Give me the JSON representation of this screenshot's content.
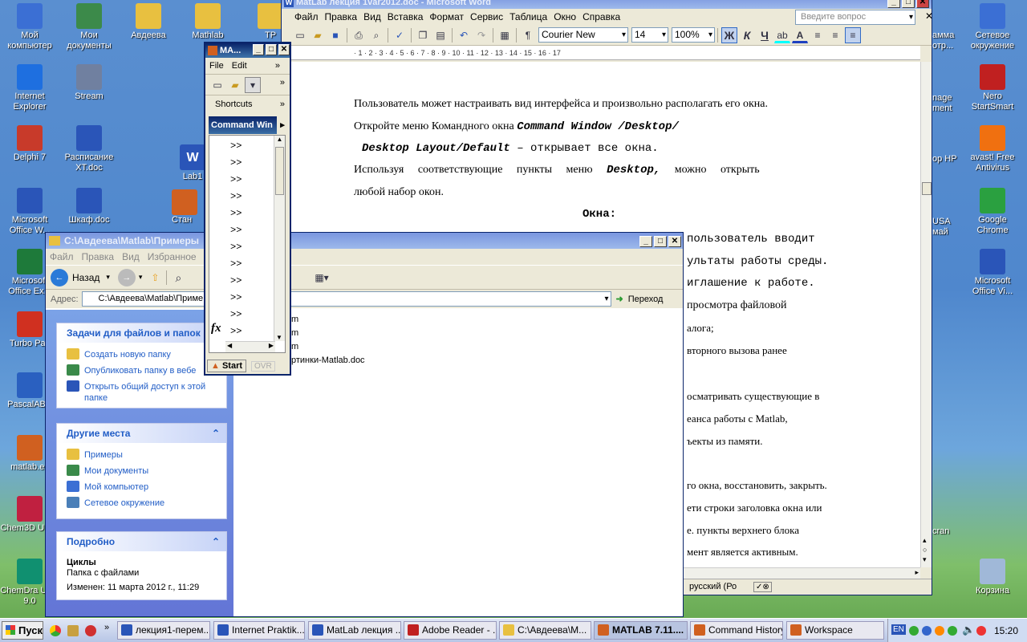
{
  "desktop_left": [
    {
      "label": "Мой компьютер",
      "color": "#3b6fd4"
    },
    {
      "label": "Internet Explorer",
      "color": "#1e6fe0"
    },
    {
      "label": "Delphi 7",
      "color": "#c83a2a"
    },
    {
      "label": "Microsoft Office W...",
      "color": "#2a55b8"
    },
    {
      "label": "Microsoft Office Ex...",
      "color": "#1e7a3a"
    },
    {
      "label": "Turbo Pas",
      "color": "#d03020"
    },
    {
      "label": "PascalABC",
      "color": "#2a60c0"
    },
    {
      "label": "matlab.ex",
      "color": "#d06020"
    },
    {
      "label": "Chem3D U 9.0",
      "color": "#c02040"
    },
    {
      "label": "ChemDra Ultra 9.0",
      "color": "#109070"
    }
  ],
  "desktop_col2": [
    {
      "label": "Мои документы",
      "color": "#3c8a4a"
    },
    {
      "label": "Stream",
      "color": "#7080a0"
    },
    {
      "label": "Расписание ХТ.doc",
      "color": "#2a55b8"
    },
    {
      "label": "Шкаф.doc",
      "color": "#2a55b8"
    }
  ],
  "desktop_top": [
    {
      "label": "Авдеева",
      "color": "#e8c040"
    },
    {
      "label": "Mathlab",
      "color": "#e8c040"
    },
    {
      "label": "TP",
      "color": "#e8c040"
    }
  ],
  "desktop_partial": {
    "lab": "Lab1",
    "stan": "Стан"
  },
  "desktop_right": [
    {
      "label": "Сетевое окружение",
      "color": "#3b6fd4"
    },
    {
      "label": "Nero StartSmart",
      "color": "#c02020"
    },
    {
      "label": "avast! Free Antivirus",
      "color": "#f07010"
    },
    {
      "label": "Google Chrome",
      "color": "#2aa040"
    },
    {
      "label": "Microsoft Office Vi...",
      "color": "#2a55b8"
    },
    {
      "label": "Корзина",
      "color": "#a0b8d8"
    }
  ],
  "desktop_right_partial": [
    "амма отр...",
    "nage ment",
    "op HP",
    "USA май",
    "cran"
  ],
  "word": {
    "title": "MatLab лекция 1var2012.doc - Microsoft Word",
    "menu": [
      "Файл",
      "Правка",
      "Вид",
      "Вставка",
      "Формат",
      "Сервис",
      "Таблица",
      "Окно",
      "Справка"
    ],
    "help_placeholder": "Введите вопрос",
    "font": "Courier New",
    "size": "14",
    "zoom": "100%",
    "ruler": "· 1 · 2 · 3 · 4 · 5 · 6 · 7 · 8 · 9 · 10 · 11 · 12 · 13 · 14 · 15 · 16 · 17",
    "lines": {
      "l1": "Пользователь может настраивать вид интерфейса и произвольно располагать его окна.",
      "l2a": "Откройте меню Командного окна ",
      "l2b": "Command Window /Desktop/",
      "l3a": "Desktop Layout/Default",
      "l3b": " – открывает все окна.",
      "l4a": "Используя соответствующие пункты меню ",
      "l4b": "Desktop,",
      "l4c": " можно открыть",
      "l5": "любой набор окон.",
      "heading": "Окна:",
      "r1": "пользователь вводит",
      "r2": "ультаты работы среды.",
      "r3": "иглашение к работе.",
      "r4": "просмотра файловой",
      "r5": "алога;",
      "r6": "вторного вызова ранее",
      "r7": "осматривать существующие в",
      "r8a": "еанса работы с ",
      "r8b": "Matlab,",
      "r9": "ъекты из памяти.",
      "r10": "го окна, восстановить, закрыть.",
      "r11": "ети строки заголовка окна или",
      "r12": "е. пункты верхнего блока",
      "r13": "мент является активным."
    },
    "status_lang": "русский (Ро"
  },
  "matlab": {
    "title": "MA...",
    "menu": [
      "File",
      "Edit"
    ],
    "shortcuts": "Shortcuts",
    "cmd_title": "Command Win",
    "prompt": ">>",
    "prompt_count": 12,
    "start": "Start",
    "ovr": "OVR",
    "fx": "fx"
  },
  "explorer": {
    "title": "C:\\Авдеева\\Matlab\\Примеры",
    "menu": [
      "Файл",
      "Правка",
      "Вид",
      "Избранное"
    ],
    "back": "Назад",
    "address_label": "Адрес:",
    "address": "C:\\Авдеева\\Matlab\\Приме",
    "go": "Переход",
    "files": [
      "m",
      "m",
      "m",
      "ртинки-Matlab.doc"
    ],
    "tasks_title": "Задачи для файлов и папок",
    "tasks": [
      "Создать новую папку",
      "Опубликовать папку в вебе",
      "Открыть общий доступ к этой папке"
    ],
    "places_title": "Другие места",
    "places": [
      "Примеры",
      "Мои документы",
      "Мой компьютер",
      "Сетевое окружение"
    ],
    "details_title": "Подробно",
    "details_name": "Циклы",
    "details_type": "Папка с файлами",
    "details_modified": "Изменен: 11 марта 2012 г., 11:29"
  },
  "taskbar": {
    "start": "Пуск",
    "tasks": [
      "лекция1-перем...",
      "Internet Praktik...",
      "MatLab лекция ...",
      "Adobe Reader - ...",
      "C:\\Авдеева\\М...",
      "MATLAB 7.11....",
      "Command History",
      "Workspace"
    ],
    "lang": "EN",
    "clock": "15:20"
  }
}
